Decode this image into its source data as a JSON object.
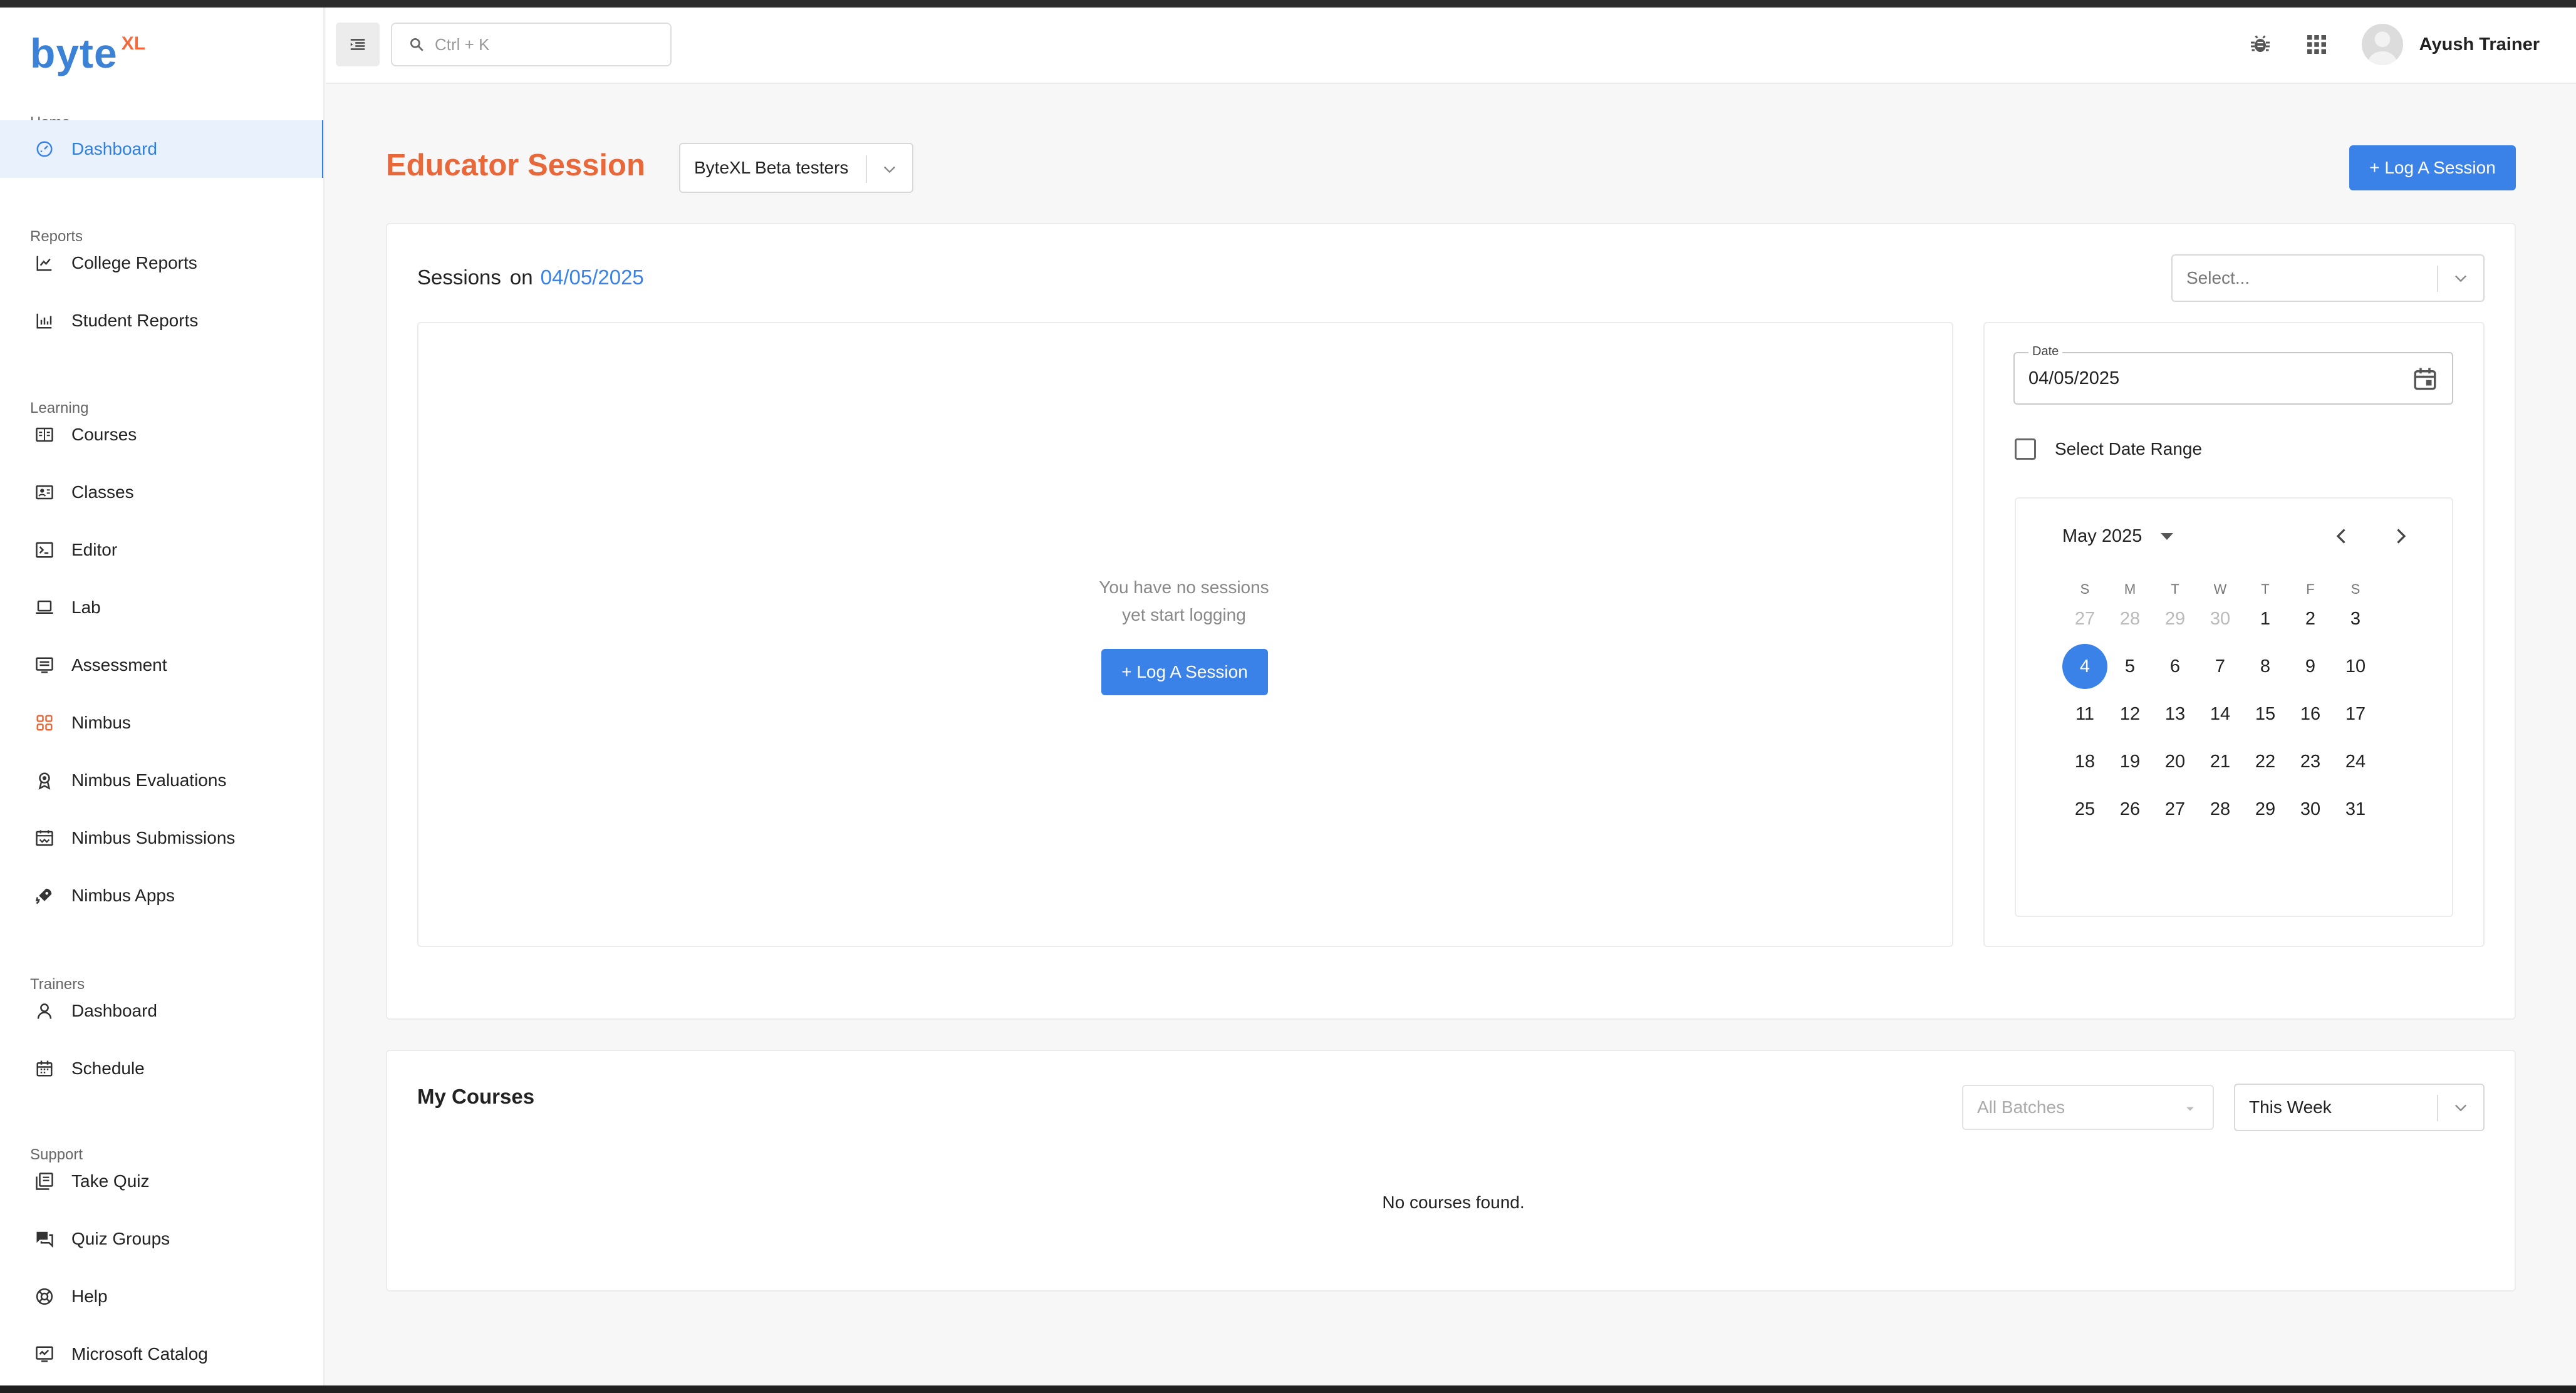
{
  "brand": {
    "logo_main": "byte",
    "logo_sup": "XL"
  },
  "search": {
    "placeholder": "Ctrl + K"
  },
  "user": {
    "name": "Ayush Trainer"
  },
  "sidebar": {
    "sections": [
      {
        "title": "Home",
        "items": [
          {
            "label": "Dashboard",
            "icon": "dashboard-icon",
            "active": true
          }
        ]
      },
      {
        "title": "Reports",
        "items": [
          {
            "label": "College Reports",
            "icon": "line-chart-icon"
          },
          {
            "label": "Student Reports",
            "icon": "bar-chart-icon"
          }
        ]
      },
      {
        "title": "Learning",
        "items": [
          {
            "label": "Courses",
            "icon": "book-icon"
          },
          {
            "label": "Classes",
            "icon": "classes-icon"
          },
          {
            "label": "Editor",
            "icon": "terminal-icon"
          },
          {
            "label": "Lab",
            "icon": "laptop-icon"
          },
          {
            "label": "Assessment",
            "icon": "assessment-icon"
          },
          {
            "label": "Nimbus",
            "icon": "nimbus-icon"
          },
          {
            "label": "Nimbus Evaluations",
            "icon": "award-icon"
          },
          {
            "label": "Nimbus Submissions",
            "icon": "submissions-icon"
          },
          {
            "label": "Nimbus Apps",
            "icon": "rocket-icon"
          }
        ]
      },
      {
        "title": "Trainers",
        "items": [
          {
            "label": "Dashboard",
            "icon": "person-icon"
          },
          {
            "label": "Schedule",
            "icon": "calendar-icon"
          }
        ]
      },
      {
        "title": "Support",
        "items": [
          {
            "label": "Take Quiz",
            "icon": "quiz-icon"
          },
          {
            "label": "Quiz Groups",
            "icon": "chat-icon"
          },
          {
            "label": "Help",
            "icon": "help-icon"
          },
          {
            "label": "Microsoft Catalog",
            "icon": "catalog-icon"
          }
        ]
      }
    ]
  },
  "header": {
    "title": "Educator Session",
    "batch": "ByteXL Beta testers",
    "log_button": "+ Log A Session"
  },
  "sessions": {
    "label": "Sessions",
    "on": "on",
    "date": "04/05/2025",
    "select_placeholder": "Select...",
    "empty_line1": "You have no sessions",
    "empty_line2": "yet start logging",
    "log_button": "+ Log A Session"
  },
  "date_panel": {
    "label": "Date",
    "value": "04/05/2025",
    "range_label": "Select Date Range"
  },
  "calendar": {
    "month": "May 2025",
    "weekdays": [
      "S",
      "M",
      "T",
      "W",
      "T",
      "F",
      "S"
    ],
    "weeks": [
      [
        "27",
        "28",
        "29",
        "30",
        "1",
        "2",
        "3"
      ],
      [
        "4",
        "5",
        "6",
        "7",
        "8",
        "9",
        "10"
      ],
      [
        "11",
        "12",
        "13",
        "14",
        "15",
        "16",
        "17"
      ],
      [
        "18",
        "19",
        "20",
        "21",
        "22",
        "23",
        "24"
      ],
      [
        "25",
        "26",
        "27",
        "28",
        "29",
        "30",
        "31"
      ]
    ],
    "muted_first_week": 4,
    "selected": "4"
  },
  "courses": {
    "title": "My Courses",
    "batches_placeholder": "All Batches",
    "period": "This Week",
    "empty": "No courses found."
  },
  "colors": {
    "accent": "#3b82e8",
    "title": "#e8683a"
  }
}
